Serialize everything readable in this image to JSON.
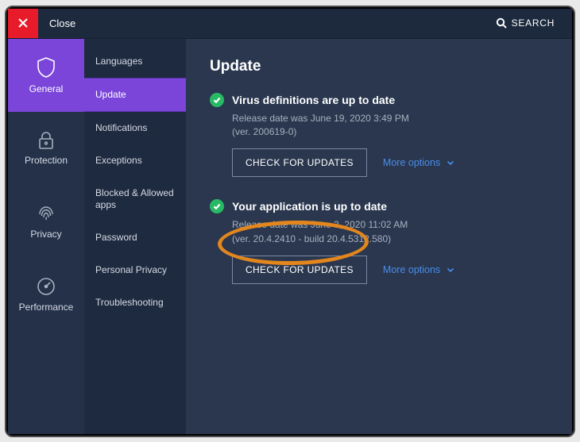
{
  "colors": {
    "purple": "#7a45d8",
    "green": "#28b965",
    "red": "#e81b2a",
    "link": "#4a8de8",
    "orange": "#e2861d"
  },
  "topbar": {
    "close_label": "Close",
    "search_label": "SEARCH"
  },
  "nav": {
    "items": [
      {
        "id": "general",
        "label": "General",
        "icon": "shield-icon",
        "active": true
      },
      {
        "id": "protection",
        "label": "Protection",
        "icon": "lock-icon",
        "active": false
      },
      {
        "id": "privacy",
        "label": "Privacy",
        "icon": "fingerprint-icon",
        "active": false
      },
      {
        "id": "performance",
        "label": "Performance",
        "icon": "gauge-icon",
        "active": false
      }
    ]
  },
  "submenu": {
    "items": [
      {
        "label": "Languages",
        "active": false
      },
      {
        "label": "Update",
        "active": true
      },
      {
        "label": "Notifications",
        "active": false
      },
      {
        "label": "Exceptions",
        "active": false
      },
      {
        "label": "Blocked & Allowed apps",
        "active": false
      },
      {
        "label": "Password",
        "active": false
      },
      {
        "label": "Personal Privacy",
        "active": false
      },
      {
        "label": "Troubleshooting",
        "active": false
      }
    ]
  },
  "main": {
    "title": "Update",
    "sections": [
      {
        "id": "virus-defs",
        "status_icon": "check-icon",
        "heading": "Virus definitions are up to date",
        "meta": "Release date was June 19, 2020 3:49 PM\n(ver. 200619-0)",
        "check_label": "CHECK FOR UPDATES",
        "more_label": "More options",
        "annotated": false
      },
      {
        "id": "application",
        "status_icon": "check-icon",
        "heading": "Your application is up to date",
        "meta": "Release date was June 3, 2020 11:02 AM\n(ver. 20.4.2410 - build 20.4.5312.580)",
        "check_label": "CHECK FOR UPDATES",
        "more_label": "More options",
        "annotated": true
      }
    ]
  }
}
